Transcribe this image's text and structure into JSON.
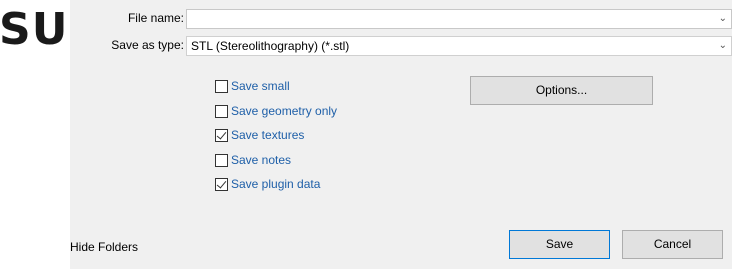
{
  "logo": {
    "text": "SU"
  },
  "file_name": {
    "label": "File name:",
    "value": ""
  },
  "save_as_type": {
    "label": "Save as type:",
    "value": "STL (Stereolithography) (*.stl)"
  },
  "checkboxes": [
    {
      "label": "Save small",
      "checked": false
    },
    {
      "label": "Save geometry only",
      "checked": false
    },
    {
      "label": "Save textures",
      "checked": true
    },
    {
      "label": "Save notes",
      "checked": false
    },
    {
      "label": "Save plugin data",
      "checked": true
    }
  ],
  "options_button": "Options...",
  "hide_folders": "Hide Folders",
  "save_button": "Save",
  "cancel_button": "Cancel"
}
